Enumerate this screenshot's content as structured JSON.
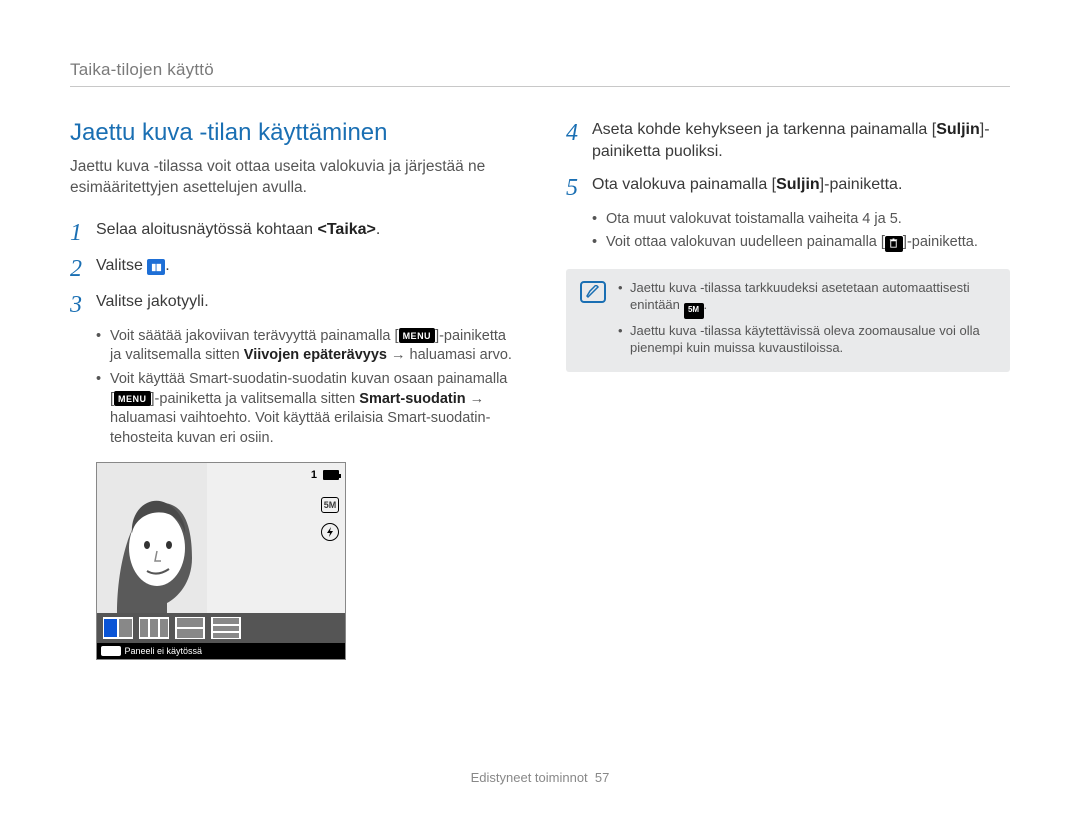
{
  "breadcrumb": "Taika-tilojen käyttö",
  "section_title": "Jaettu kuva -tilan käyttäminen",
  "intro": "Jaettu kuva -tilassa voit ottaa useita valokuvia ja järjestää ne esimääritettyjen asettelujen avulla.",
  "steps": {
    "1": {
      "num": "1",
      "text_before": "Selaa aloitusnäytössä kohtaan ",
      "bold": "<Taika>",
      "text_after": "."
    },
    "2": {
      "num": "2",
      "text": "Valitse "
    },
    "3": {
      "num": "3",
      "text": "Valitse jakotyyli.",
      "bullets": [
        {
          "pre": "Voit säätää jakoviivan terävyyttä painamalla [",
          "badge": "MENU",
          "mid": "]-painiketta ja valitsemalla sitten ",
          "bold": "Viivojen epäterävyys",
          "post": " → haluamasi arvo."
        },
        {
          "pre": "Voit käyttää Smart-suodatin-suodatin kuvan osaan painamalla [",
          "badge": "MENU",
          "mid": "]-painiketta ja valitsemalla sitten ",
          "bold": "Smart-suodatin",
          "post": " → haluamasi vaihtoehto. Voit käyttää erilaisia Smart-suodatin-tehosteita kuvan eri osiin."
        }
      ]
    },
    "4": {
      "num": "4",
      "text_before": "Aseta kohde kehykseen ja tarkenna painamalla [",
      "bold": "Suljin",
      "text_after": "]-painiketta puoliksi."
    },
    "5": {
      "num": "5",
      "text_before": "Ota valokuva painamalla [",
      "bold": "Suljin",
      "text_after": "]-painiketta.",
      "bullets": [
        {
          "text": "Ota muut valokuvat toistamalla vaiheita 4 ja 5."
        },
        {
          "pre": "Voit ottaa valokuvan uudelleen painamalla [",
          "icon": "trash",
          "post": "]-painiketta."
        }
      ]
    }
  },
  "note": {
    "items": [
      {
        "pre": "Jaettu kuva -tilassa tarkkuudeksi asetetaan automaattisesti enintään ",
        "icon_label": "5M",
        "post": "."
      },
      {
        "text": "Jaettu kuva -tilassa käytettävissä oleva zoomausalue voi olla pienempi kuin muissa kuvaustiloissa."
      }
    ]
  },
  "screenshot": {
    "count": "1",
    "size_label": "5M",
    "caption": "Paneeli ei käytössä",
    "ok": "OK"
  },
  "footer": {
    "label": "Edistyneet toiminnot",
    "page": "57"
  }
}
